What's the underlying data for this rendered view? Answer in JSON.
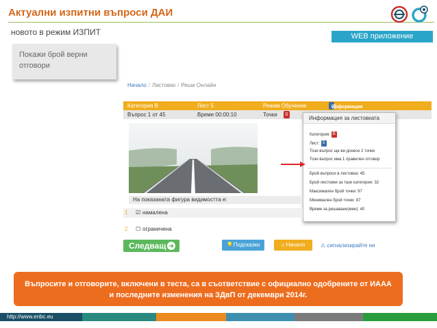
{
  "slide": {
    "title": "Актуални изпитни въпроси ДАИ",
    "subtitle": "новото  в режим ИЗПИТ",
    "web_badge": "WEB приложение",
    "callout": "Покажи брой верни отговори",
    "notice_line1": "Въпросите и отговорите, включени в теста, са в съответствие с официално одобрените от ИААА",
    "notice_line2": "и последните изменения на ЗДвП от декември 2014г.",
    "url": "http://www.enbc.eu"
  },
  "screenshot": {
    "breadcrumb": [
      "Начало",
      "Листовки",
      "Реши Онлайн"
    ],
    "bar_yellow": {
      "category": "Категория B",
      "sheet": "Лист 5",
      "mode": "Режим Обучение",
      "info_button": "Информация"
    },
    "bar_grey": {
      "question": "Въпрос 1 от 45",
      "time": "Време 00:00:10",
      "points": "Точки",
      "points_value": "0"
    },
    "popover": {
      "title": "Информация за листовката",
      "category_label": "Категория:",
      "category_value": "B",
      "sheet_label": "Лист:",
      "sheet_value": "5",
      "points_line": "Този въпрос ще ви донесе 2 точки",
      "correct_line": "Този въпрос има 1 правилен отговор",
      "q_count": "Брой въпроси в листовка: 45",
      "sheets_count": "Брой листовки за тази категория: 32",
      "max_points": "Максимален брой точки: 97",
      "min_points": "Минимален брой точки: 87",
      "time_limit": "Време за решаване(мин): 40"
    },
    "question": "На показаната фигура видимостта е:",
    "answers": [
      {
        "num": "1",
        "text": "намалена",
        "checked": true
      },
      {
        "num": "2",
        "text": "ограничена",
        "checked": false
      }
    ],
    "next_button": "Следващ",
    "hint_button": "Подсказки",
    "start_button": "Начало",
    "report_link": "сигнализирайте ни"
  },
  "colors": {
    "title": "#d4661a",
    "badge": "#2aa5c9",
    "notice": "#ed6d1f",
    "yellow_bar": "#f0ad1e",
    "green_button": "#5cb85c",
    "footer": [
      "#1a4f66",
      "#ed6d1f",
      "#3e8fb0",
      "#7b7b7b",
      "#2a9d3d"
    ]
  }
}
